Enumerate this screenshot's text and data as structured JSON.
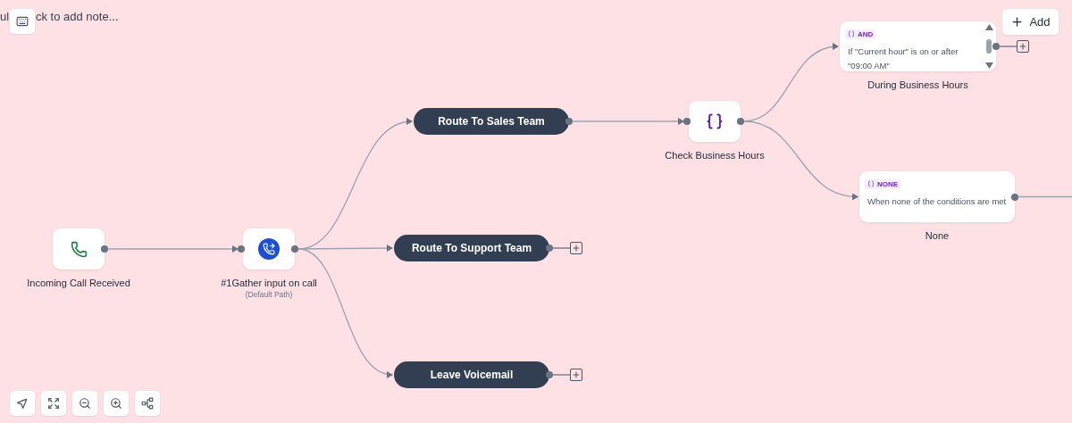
{
  "note": {
    "parts": [
      "ul",
      "ck to add note..."
    ]
  },
  "add_button": {
    "label": "Add"
  },
  "nodes": [
    {
      "kind": "trigger",
      "label": "Incoming Call Received"
    },
    {
      "kind": "action",
      "label": "#1Gather input on call",
      "sublabel": "(Default Path)"
    },
    {
      "kind": "route",
      "label": "Route To Sales Team",
      "add": false
    },
    {
      "kind": "route",
      "label": "Route To Support Team",
      "add": true
    },
    {
      "kind": "route",
      "label": "Leave Voicemail",
      "add": true
    },
    {
      "kind": "condition",
      "label": "Check Business Hours"
    },
    {
      "kind": "branch",
      "badge": "AND",
      "lines": [
        "If \"Current hour\" is on or after",
        "\"09:00 AM\""
      ],
      "label": "During Business Hours",
      "add": true,
      "scrollable": true
    },
    {
      "kind": "branch",
      "badge": "NONE",
      "lines": [
        "When none of the conditions are met"
      ],
      "label": "None",
      "add": false,
      "scrollable": false
    }
  ]
}
